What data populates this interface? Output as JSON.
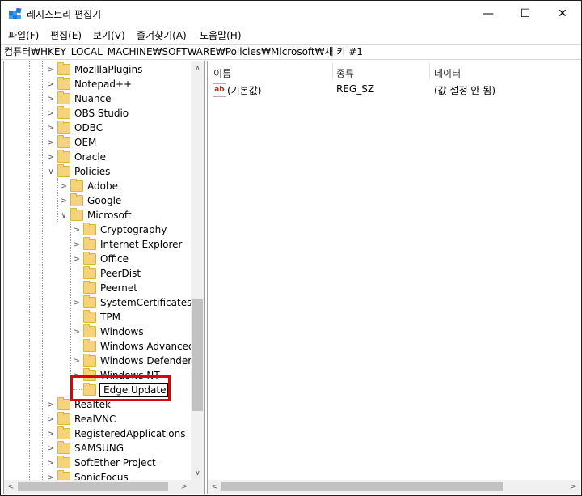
{
  "window": {
    "title": "레지스트리 편집기",
    "minimize": "—",
    "maximize": "☐",
    "close": "✕"
  },
  "menu": [
    "파일(F)",
    "편집(E)",
    "보기(V)",
    "즐겨찾기(A)",
    "도움말(H)"
  ],
  "address": "컴퓨터₩HKEY_LOCAL_MACHINE₩SOFTWARE₩Policies₩Microsoft₩새 키 #1",
  "tree": {
    "level1": [
      "MozillaPlugins",
      "Notepad++",
      "Nuance",
      "OBS Studio",
      "ODBC",
      "OEM",
      "Oracle",
      "Policies"
    ],
    "policies_children": [
      "Adobe",
      "Google",
      "Microsoft"
    ],
    "microsoft_children": [
      "Cryptography",
      "Internet Explorer",
      "Office",
      "PeerDist",
      "Peernet",
      "SystemCertificates",
      "TPM",
      "Windows",
      "Windows Advanced",
      "Windows Defender",
      "Windows NT"
    ],
    "editing_key": "Edge Update",
    "level1_after": [
      "Realtek",
      "RealVNC",
      "RegisteredApplications",
      "SAMSUNG",
      "SoftEther Project",
      "SonicFocus"
    ]
  },
  "list": {
    "columns": [
      "이름",
      "종류",
      "데이터"
    ],
    "rows": [
      {
        "icon": "ab",
        "name": "(기본값)",
        "type": "REG_SZ",
        "data": "(값 설정 안 됨)"
      }
    ]
  },
  "colors": {
    "highlight_box": "#e00000",
    "folder": "#f5d37a"
  }
}
